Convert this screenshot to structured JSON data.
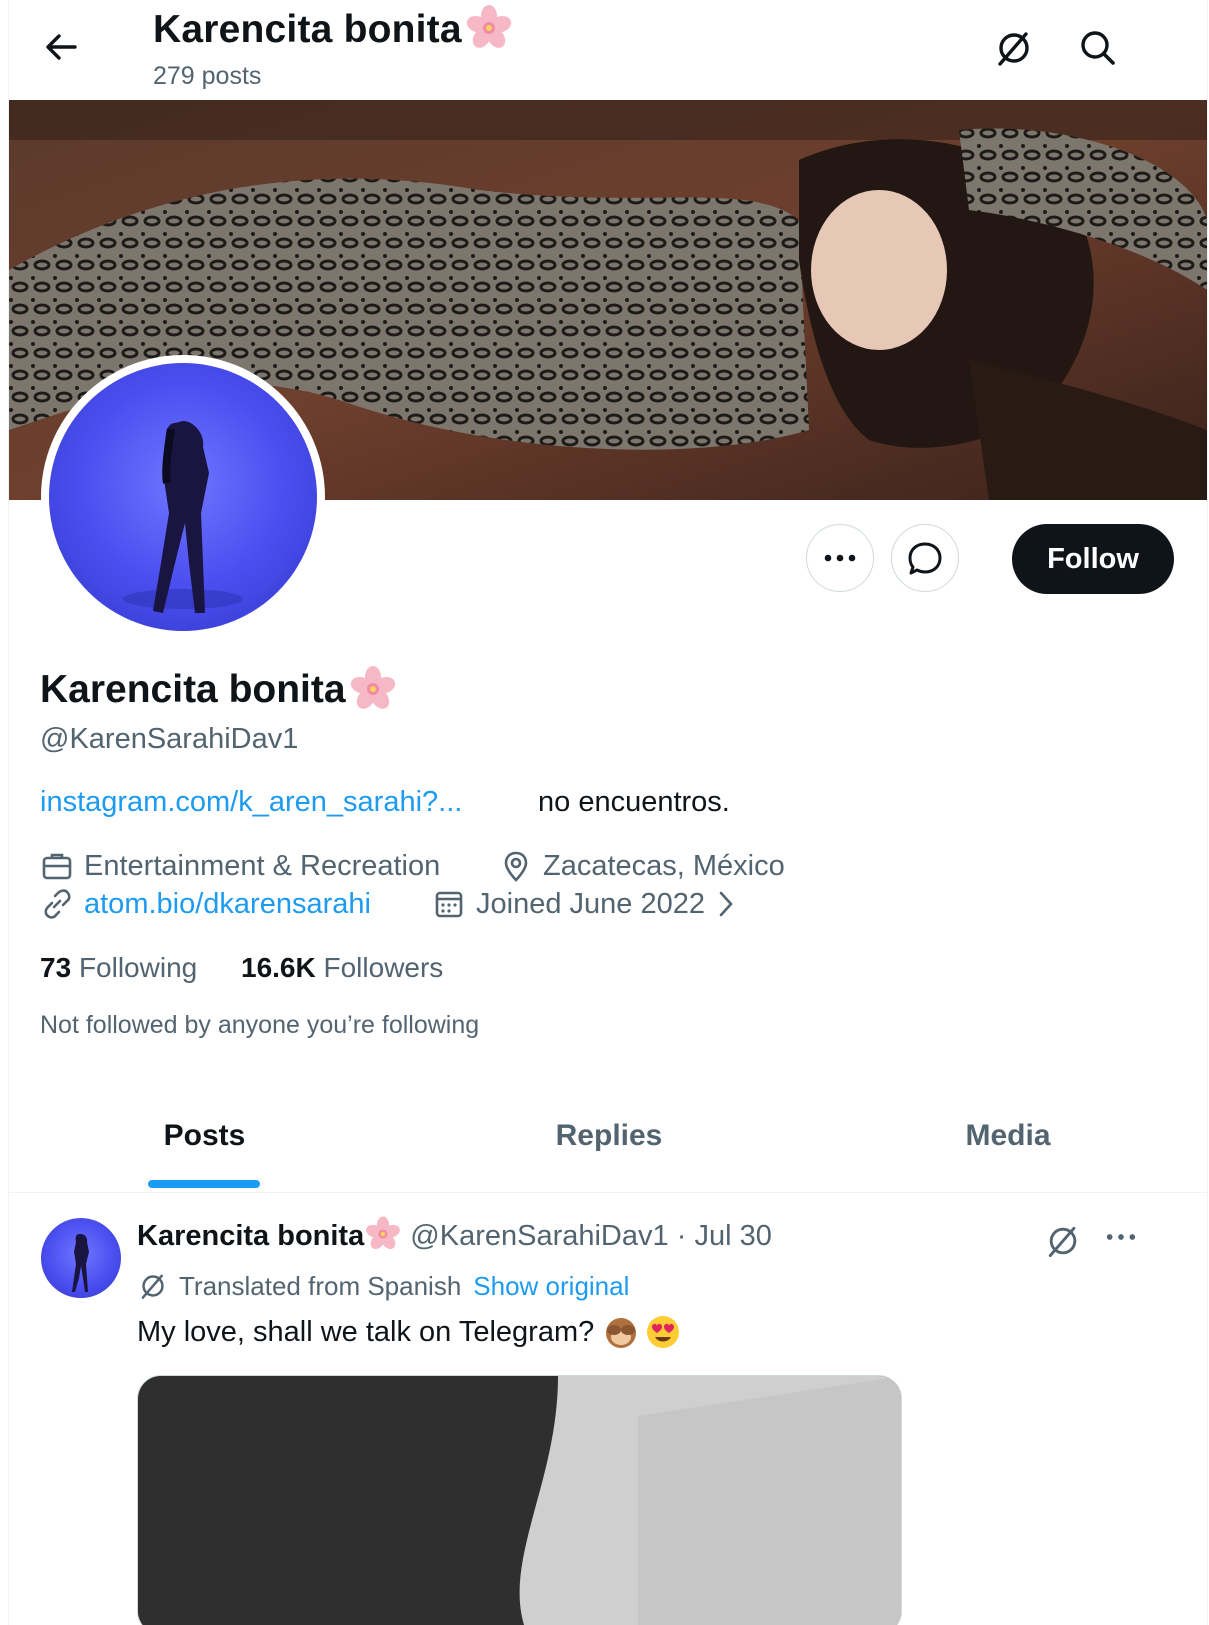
{
  "header": {
    "title": "Karencita bonita",
    "post_count": "279 posts"
  },
  "profile": {
    "name": "Karencita bonita",
    "handle": "@KarenSarahiDav1",
    "bio_link": "instagram.com/k_aren_sarahi?...",
    "bio_text": "no encuentros.",
    "category": "Entertainment & Recreation",
    "location": "Zacatecas, México",
    "website": "atom.bio/dkarensarahi",
    "joined": "Joined June 2022",
    "following_count": "73",
    "following_label": "Following",
    "followers_count": "16.6K",
    "followers_label": "Followers",
    "not_followed": "Not followed by anyone you’re following"
  },
  "actions": {
    "follow_label": "Follow"
  },
  "tabs": [
    {
      "label": "Posts",
      "active": true
    },
    {
      "label": "Replies",
      "active": false
    },
    {
      "label": "Media",
      "active": false
    }
  ],
  "post": {
    "author_name": "Karencita bonita",
    "author_handle": "@KarenSarahiDav1",
    "separator": "·",
    "date": "Jul 30",
    "translated_note": "Translated from Spanish",
    "show_original": "Show original",
    "text": "My love, shall we talk on Telegram?"
  },
  "colors": {
    "accent": "#1d9bf0",
    "text_primary": "#0f1419",
    "text_secondary": "#536471",
    "follow_bg": "#0f1419",
    "avatar_bg": "#4b4ff0"
  },
  "icons": {
    "back": "arrow-left-icon",
    "translate": "translate-icon",
    "search": "search-icon",
    "more": "more-icon",
    "message": "message-icon",
    "category": "briefcase-icon",
    "location": "location-pin-icon",
    "website": "link-icon",
    "joined": "calendar-icon",
    "flower": "cherry-blossom-icon",
    "emoji_1": "see-no-evil-monkey-icon",
    "emoji_2": "heart-eyes-icon"
  }
}
